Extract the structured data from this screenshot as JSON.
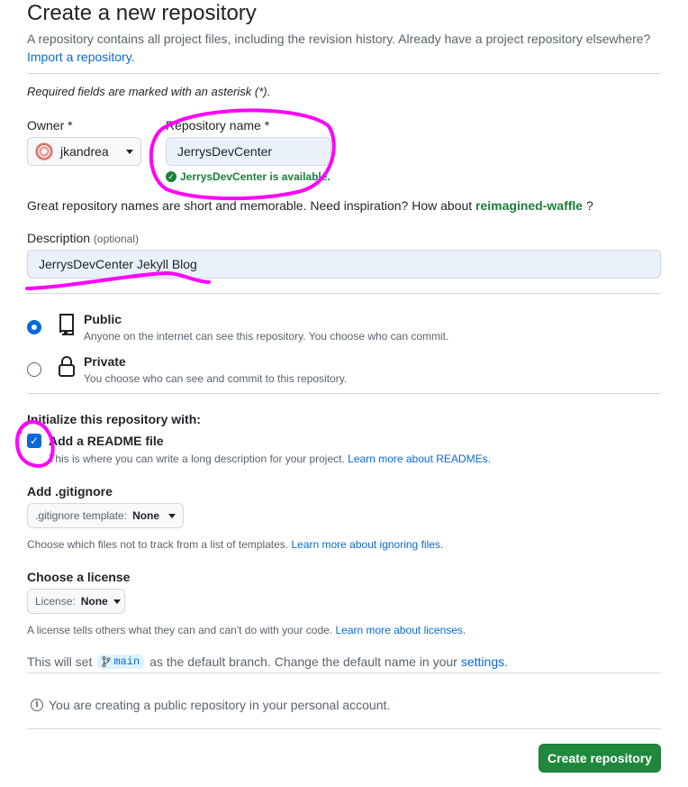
{
  "header": {
    "title": "Create a new repository",
    "subtitle": "A repository contains all project files, including the revision history. Already have a project repository elsewhere?",
    "import_link": "Import a repository."
  },
  "required_note": "Required fields are marked with an asterisk (*).",
  "owner": {
    "label": "Owner *",
    "value": "jkandrea"
  },
  "repo_name": {
    "label": "Repository name *",
    "value": "JerrysDevCenter",
    "availability": "JerrysDevCenter is available."
  },
  "inspiration": {
    "text": "Great repository names are short and memorable. Need inspiration? How about",
    "suggestion": "reimagined-waffle",
    "suffix": "?"
  },
  "description": {
    "label": "Description",
    "optional": "(optional)",
    "value": "JerrysDevCenter Jekyll Blog"
  },
  "visibility": {
    "options": [
      {
        "title": "Public",
        "desc": "Anyone on the internet can see this repository. You choose who can commit.",
        "selected": true,
        "icon": "repo-icon"
      },
      {
        "title": "Private",
        "desc": "You choose who can see and commit to this repository.",
        "selected": false,
        "icon": "lock-icon"
      }
    ]
  },
  "initialize": {
    "label": "Initialize this repository with:",
    "readme_label": "Add a README file",
    "readme_checked": true,
    "readme_desc": "This is where you can write a long description for your project.",
    "readme_link": "Learn more about READMEs."
  },
  "gitignore": {
    "label": "Add .gitignore",
    "select_prefix": ".gitignore template:",
    "select_value": "None",
    "desc": "Choose which files not to track from a list of templates.",
    "link": "Learn more about ignoring files."
  },
  "license": {
    "label": "Choose a license",
    "select_prefix": "License:",
    "select_value": "None",
    "desc": "A license tells others what they can and can't do with your code.",
    "link": "Learn more about licenses."
  },
  "branch": {
    "prefix": "This will set",
    "branch_name": "main",
    "middle": "as the default branch. Change the default name in your",
    "settings_link": "settings",
    "suffix": "."
  },
  "info": "You are creating a public repository in your personal account.",
  "create_button": "Create repository",
  "colors": {
    "accent": "#0969da",
    "success": "#1a7f37",
    "primary_button": "#1f883d",
    "annotation": "#ff00ff"
  }
}
